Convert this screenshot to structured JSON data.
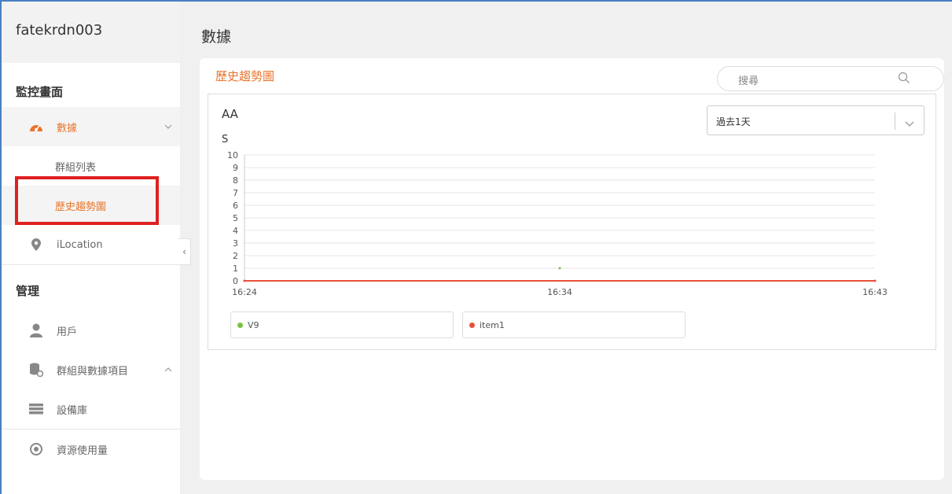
{
  "sidebar": {
    "title": "fatekrdn003",
    "section_monitor": "監控畫面",
    "section_manage": "管理",
    "items": [
      {
        "label": "數據",
        "icon": "dashboard-icon"
      },
      {
        "label": "群組列表"
      },
      {
        "label": "歷史趨勢圖"
      },
      {
        "label": "iLocation",
        "icon": "location-pin-icon"
      },
      {
        "label": "用戶",
        "icon": "user-icon"
      },
      {
        "label": "群組與數據項目",
        "icon": "database-gear-icon"
      },
      {
        "label": "設備庫",
        "icon": "server-rack-icon"
      },
      {
        "label": "資源使用量",
        "icon": "resource-usage-icon"
      }
    ],
    "collapse_label": "‹"
  },
  "page": {
    "title": "數據"
  },
  "card": {
    "title": "歷史趨勢圖",
    "search_placeholder": "搜尋"
  },
  "chart": {
    "name": "AA",
    "unit": "S",
    "range_value": "過去1天"
  },
  "colors": {
    "accent": "#e8762e",
    "series_v9": "#7ac143",
    "series_item1": "#e8503a"
  },
  "chart_data": {
    "type": "line",
    "x_ticks": [
      "16:24",
      "16:34",
      "16:43"
    ],
    "ylim": [
      0,
      10
    ],
    "y_ticks": [
      0,
      1,
      2,
      3,
      4,
      5,
      6,
      7,
      8,
      9,
      10
    ],
    "ylabel": "S",
    "series": [
      {
        "name": "V9",
        "color": "#7ac143",
        "points": [
          {
            "x": "16:34",
            "y": 1
          }
        ]
      },
      {
        "name": "item1",
        "color": "#e8503a",
        "points": [
          {
            "x": "16:24",
            "y": 0
          },
          {
            "x": "16:43",
            "y": 0
          }
        ]
      }
    ]
  }
}
